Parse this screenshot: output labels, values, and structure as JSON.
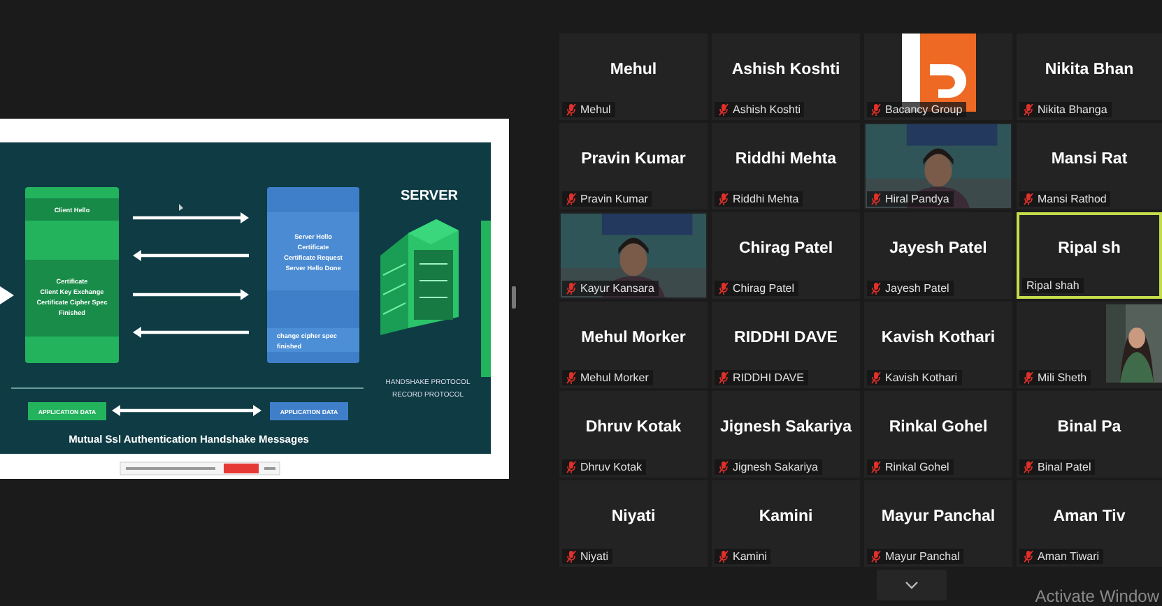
{
  "shared_screen": {
    "slide": {
      "client_hello": "Client Hello",
      "client_lines": [
        "Certificate",
        "Client Key Exchange",
        "Certificate Cipher Spec",
        "Finished"
      ],
      "server_lines": [
        "Server Hello",
        "Certificate",
        "Certificate Request",
        "Server Hello Done"
      ],
      "server_finish": [
        "change cipher spec",
        "finished"
      ],
      "server_label": "SERVER",
      "protocol_labels": [
        "HANDSHAKE PROTOCOL",
        "RECORD PROTOCOL"
      ],
      "app_data": [
        "APPLICATION DATA",
        "APPLICATION DATA"
      ],
      "title": "Mutual Ssl Authentication Handshake Messages"
    }
  },
  "participants": [
    {
      "kind": "name",
      "display_name": "Mehul",
      "label": "Mehul",
      "muted": true,
      "speaking": false
    },
    {
      "kind": "name",
      "display_name": "Ashish Koshti",
      "label": "Ashish Koshti",
      "muted": true,
      "speaking": false
    },
    {
      "kind": "logo",
      "label": "Bacancy Group",
      "muted": true,
      "speaking": false
    },
    {
      "kind": "name",
      "display_name": "Nikita  Bhan",
      "label": "Nikita Bhanga",
      "muted": true,
      "speaking": false
    },
    {
      "kind": "name",
      "display_name": "Pravin Kumar",
      "label": "Pravin Kumar",
      "muted": true,
      "speaking": false
    },
    {
      "kind": "name",
      "display_name": "Riddhi Mehta",
      "label": "Riddhi Mehta",
      "muted": true,
      "speaking": false
    },
    {
      "kind": "video",
      "label": "Hiral Pandya",
      "muted": true,
      "speaking": false
    },
    {
      "kind": "name",
      "display_name": "Mansi Rat",
      "label": "Mansi Rathod",
      "muted": true,
      "speaking": false
    },
    {
      "kind": "video",
      "label": "Kayur Kansara",
      "muted": true,
      "speaking": false
    },
    {
      "kind": "name",
      "display_name": "Chirag Patel",
      "label": "Chirag Patel",
      "muted": true,
      "speaking": false
    },
    {
      "kind": "name",
      "display_name": "Jayesh Patel",
      "label": "Jayesh Patel",
      "muted": true,
      "speaking": false
    },
    {
      "kind": "name",
      "display_name": "Ripal sh",
      "label": "Ripal shah",
      "muted": false,
      "speaking": true
    },
    {
      "kind": "name",
      "display_name": "Mehul Morker",
      "label": "Mehul Morker",
      "muted": true,
      "speaking": false
    },
    {
      "kind": "name",
      "display_name": "RIDDHI DAVE",
      "label": "RIDDHI DAVE",
      "muted": true,
      "speaking": false
    },
    {
      "kind": "name",
      "display_name": "Kavish Kothari",
      "label": "Kavish Kothari",
      "muted": true,
      "speaking": false
    },
    {
      "label": "Mili Sheth",
      "muted": true,
      "speaking": false
    },
    {
      "kind": "name",
      "display_name": "Dhruv Kotak",
      "label": "Dhruv Kotak",
      "muted": true,
      "speaking": false
    },
    {
      "kind": "name",
      "display_name": "Jignesh Sakariya",
      "label": "Jignesh Sakariya",
      "muted": true,
      "speaking": false
    },
    {
      "kind": "name",
      "display_name": "Rinkal Gohel",
      "label": "Rinkal Gohel",
      "muted": true,
      "speaking": false
    },
    {
      "kind": "name",
      "display_name": "Binal Pa",
      "label": "Binal Patel",
      "muted": true,
      "speaking": false
    },
    {
      "kind": "name",
      "display_name": "Niyati",
      "label": "Niyati",
      "muted": true,
      "speaking": false
    },
    {
      "kind": "name",
      "display_name": "Kamini",
      "label": "Kamini",
      "muted": true,
      "speaking": false
    },
    {
      "kind": "name",
      "display_name": "Mayur Panchal",
      "label": "Mayur Panchal",
      "muted": true,
      "speaking": false
    },
    {
      "kind": "name",
      "display_name": "Aman Tiv",
      "label": "Aman Tiwari",
      "muted": true,
      "speaking": false
    }
  ],
  "system_notice": "Activate Window"
}
